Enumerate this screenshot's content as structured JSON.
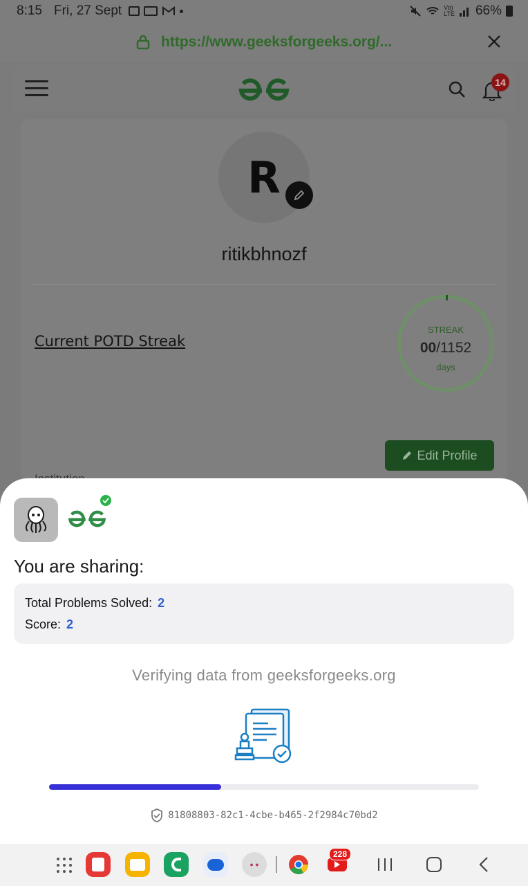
{
  "status_bar": {
    "time": "8:15",
    "date": "Fri, 27 Sept",
    "battery": "66%",
    "icons": [
      "gallery-icon",
      "paytm-icon",
      "gmail-icon",
      "dot-icon",
      "mute-icon",
      "wifi-icon",
      "volte-icon",
      "signal-icon",
      "battery-icon"
    ]
  },
  "browser": {
    "url": "https://www.geeksforgeeks.org/...",
    "accent": "#3c8a35"
  },
  "site_header": {
    "notification_count": "14"
  },
  "profile": {
    "avatar_initial": "R",
    "username": "ritikbhnozf",
    "potd_link": "Current POTD Streak",
    "streak": {
      "label": "STREAK",
      "current": "00",
      "separator": "/",
      "total": "1152",
      "unit": "days"
    },
    "edit_button": "Edit Profile",
    "institution_label": "Institution"
  },
  "sheet": {
    "title": "You are sharing:",
    "items": [
      {
        "label": "Total Problems Solved:",
        "value": "2"
      },
      {
        "label": "Score:",
        "value": "2"
      }
    ],
    "status_text": "Verifying data from geeksforgeeks.org",
    "progress_fraction": 0.4,
    "session_id": "81808803-82c1-4cbe-b465-2f2984c70bd2"
  },
  "nav_bar": {
    "youtube_badge": "228"
  },
  "colors": {
    "gfg_green": "#2f8d46",
    "progress": "#3730d8",
    "value_blue": "#2d5fd1"
  }
}
